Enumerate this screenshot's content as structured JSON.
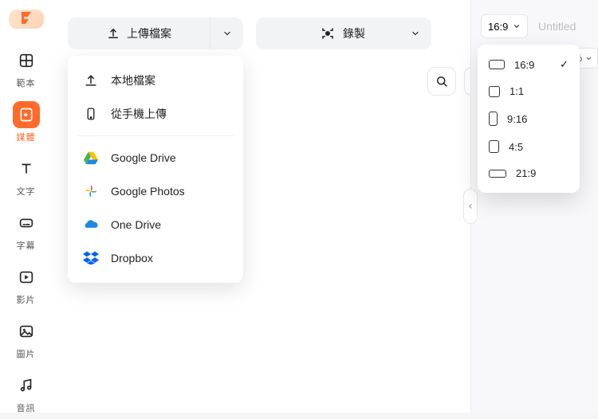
{
  "sidebar": {
    "items": [
      {
        "label": "範本"
      },
      {
        "label": "媒體"
      },
      {
        "label": "文字"
      },
      {
        "label": "字幕"
      },
      {
        "label": "影片"
      },
      {
        "label": "圖片"
      },
      {
        "label": "音訊"
      }
    ]
  },
  "toolbar": {
    "upload_label": "上傳檔案",
    "record_label": "錄製"
  },
  "upload_menu": {
    "local": "本地檔案",
    "phone": "從手機上傳",
    "gdrive": "Google Drive",
    "gphotos": "Google Photos",
    "onedrive": "One Drive",
    "dropbox": "Dropbox"
  },
  "right": {
    "aspect_selected": "16:9",
    "title": "Untitled",
    "zoom": "%",
    "ratios": [
      {
        "label": "16:9",
        "checked": true
      },
      {
        "label": "1:1"
      },
      {
        "label": "9:16"
      },
      {
        "label": "4:5"
      },
      {
        "label": "21:9"
      }
    ]
  }
}
